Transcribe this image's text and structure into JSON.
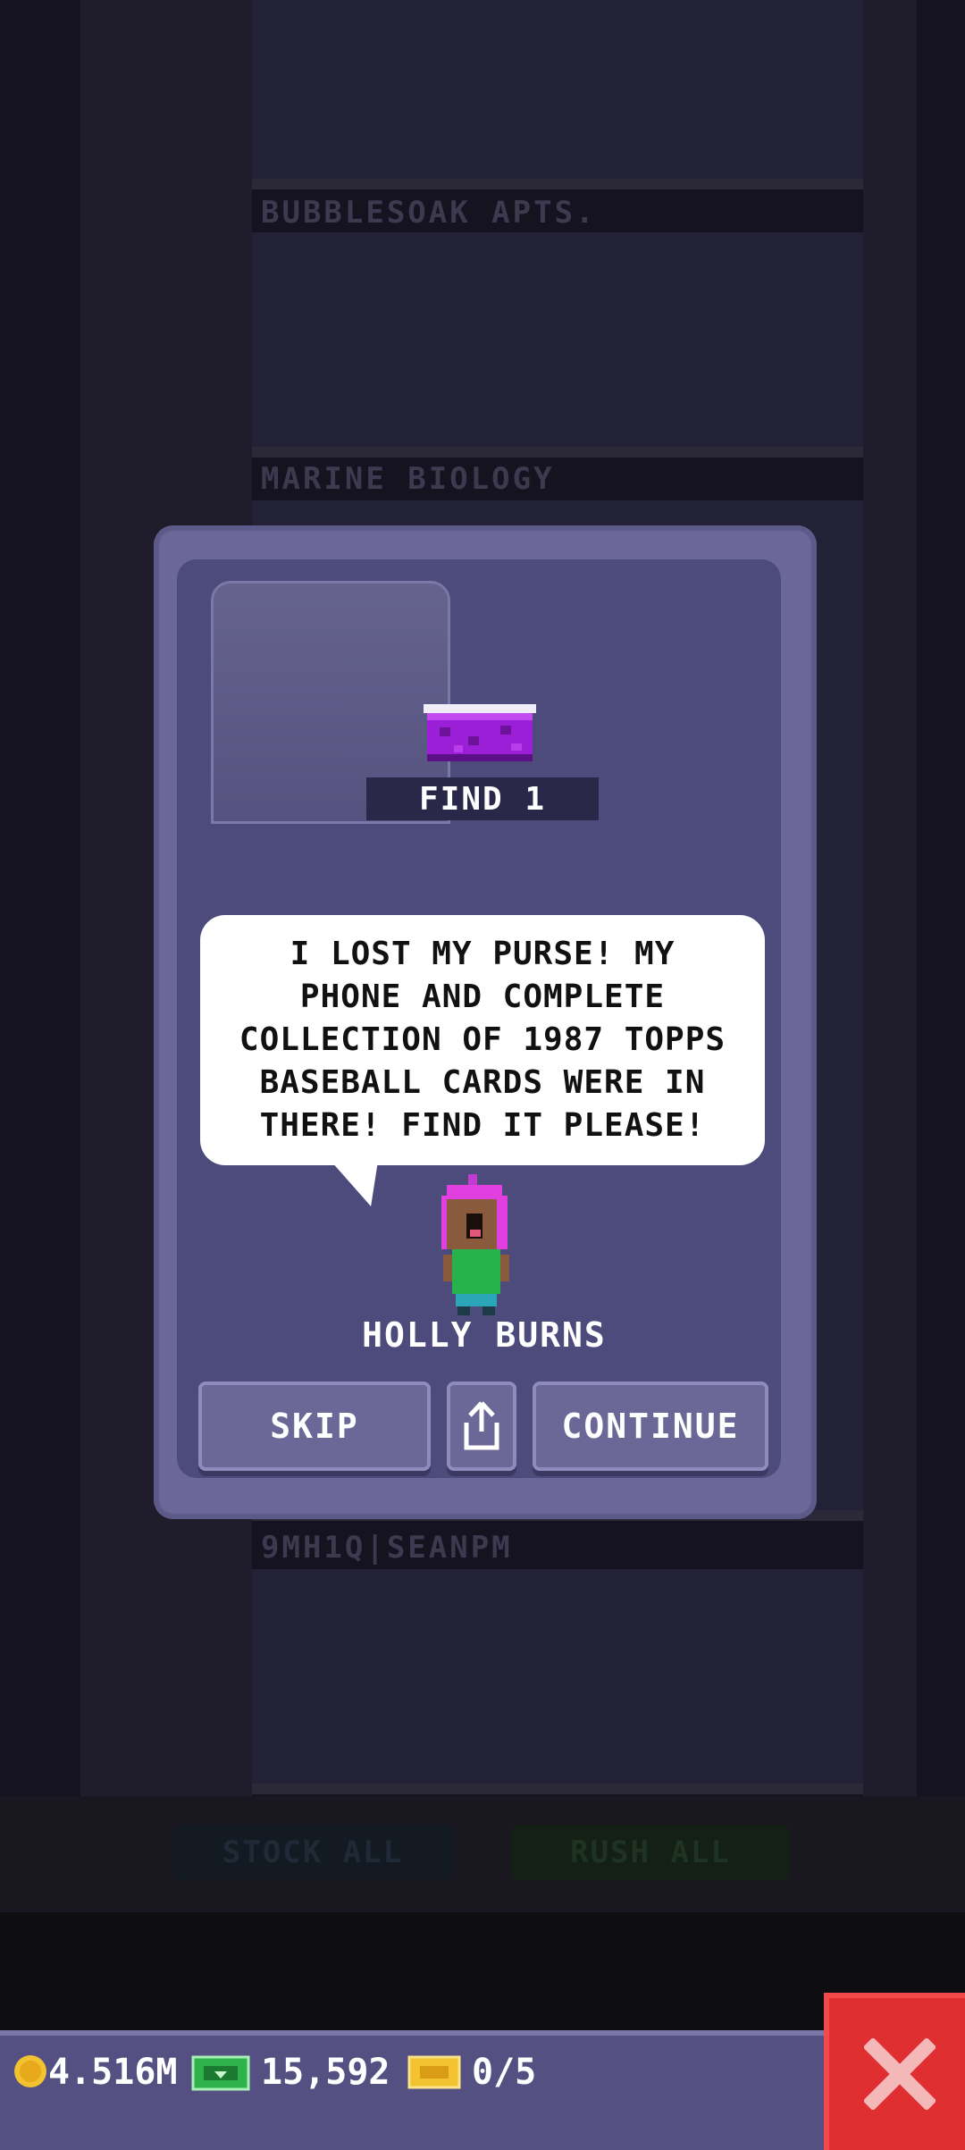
{
  "background": {
    "floors": [
      {
        "name": "BUBBLESOAK APTS."
      },
      {
        "name": "MARINE BIOLOGY"
      },
      {
        "name": "9MH1Q|SEANPM"
      }
    ],
    "stock_all_label": "STOCK ALL",
    "rush_all_label": "RUSH ALL"
  },
  "mission": {
    "item_label": "FIND 1",
    "message": "I LOST MY PURSE! MY PHONE AND COMPLETE COLLECTION OF 1987 TOPPS BASEBALL CARDS WERE IN THERE! FIND IT PLEASE!",
    "character_name": "HOLLY BURNS",
    "skip_label": "SKIP",
    "continue_label": "CONTINUE"
  },
  "hud": {
    "coins": "4.516M",
    "bux": "15,592",
    "tickets": "0/5"
  },
  "colors": {
    "modal": "#4d4a7c",
    "close_button": "#e02f31",
    "purse": "#9b1fd6",
    "coin": "#f2c230",
    "bux": "#2fb24a"
  }
}
